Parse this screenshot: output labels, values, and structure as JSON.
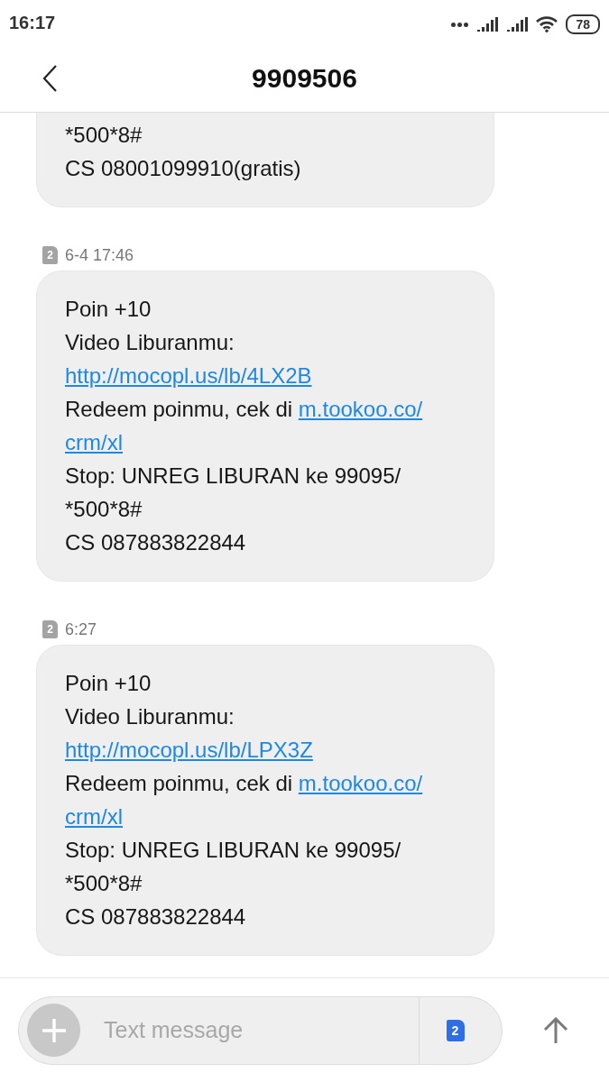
{
  "status_bar": {
    "time": "16:17",
    "battery": "78"
  },
  "header": {
    "title": "9909506"
  },
  "messages": [
    {
      "lines": [
        [
          {
            "kind": "text",
            "text": "*500*8#"
          }
        ],
        [
          {
            "kind": "text",
            "text": "CS 08001099910(gratis)"
          }
        ]
      ]
    },
    {
      "sim": "2",
      "time": "6-4 17:46",
      "lines": [
        [
          {
            "kind": "text",
            "text": "Poin +10"
          }
        ],
        [
          {
            "kind": "text",
            "text": "Video Liburanmu:"
          }
        ],
        [
          {
            "kind": "link",
            "text": "http://mocopl.us/lb/4LX2B"
          }
        ],
        [
          {
            "kind": "text",
            "text": "Redeem poinmu, cek di "
          },
          {
            "kind": "link",
            "text": "m.tookoo.co/"
          }
        ],
        [
          {
            "kind": "link",
            "text": "crm/xl"
          }
        ],
        [
          {
            "kind": "text",
            "text": "Stop: UNREG LIBURAN ke 99095/"
          }
        ],
        [
          {
            "kind": "text",
            "text": "*500*8#"
          }
        ],
        [
          {
            "kind": "text",
            "text": "CS 087883822844"
          }
        ]
      ]
    },
    {
      "sim": "2",
      "time": "6:27",
      "lines": [
        [
          {
            "kind": "text",
            "text": "Poin +10"
          }
        ],
        [
          {
            "kind": "text",
            "text": "Video Liburanmu:"
          }
        ],
        [
          {
            "kind": "link",
            "text": "http://mocopl.us/lb/LPX3Z"
          }
        ],
        [
          {
            "kind": "text",
            "text": "Redeem poinmu, cek di "
          },
          {
            "kind": "link",
            "text": "m.tookoo.co/"
          }
        ],
        [
          {
            "kind": "link",
            "text": "crm/xl"
          }
        ],
        [
          {
            "kind": "text",
            "text": "Stop: UNREG LIBURAN ke 99095/"
          }
        ],
        [
          {
            "kind": "text",
            "text": "*500*8#"
          }
        ],
        [
          {
            "kind": "text",
            "text": "CS 087883822844"
          }
        ]
      ]
    }
  ],
  "composer": {
    "placeholder": "Text message",
    "sim": "2"
  }
}
